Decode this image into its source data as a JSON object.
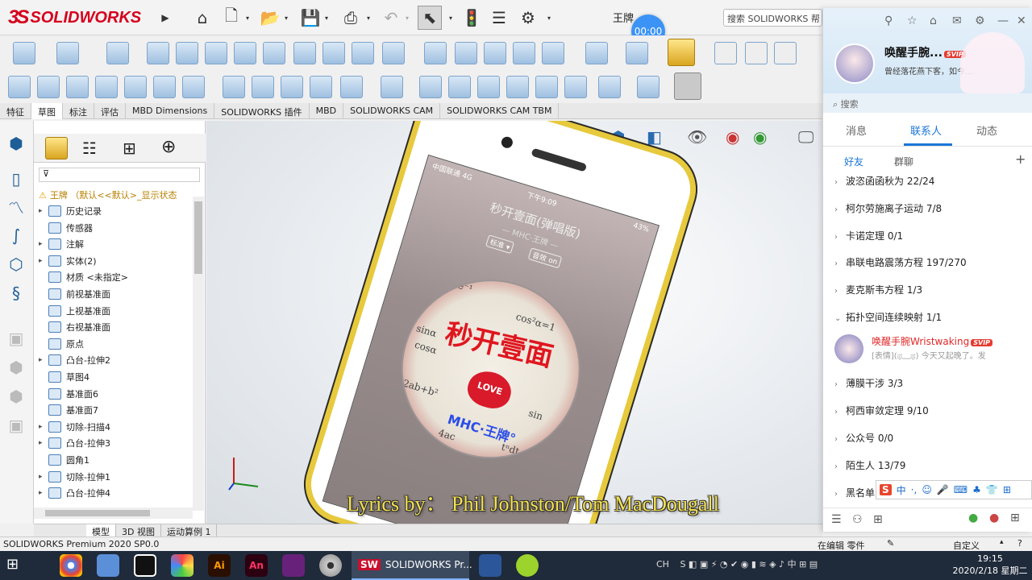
{
  "app": {
    "logo_text": "SOLIDWORKS",
    "logo_mark": "3S",
    "doc_title": "王牌",
    "search_placeholder": "搜索 SOLIDWORKS 帮"
  },
  "timer": "00:00",
  "command_tabs": [
    "特征",
    "草图",
    "标注",
    "评估",
    "MBD Dimensions",
    "SOLIDWORKS 插件",
    "MBD",
    "SOLIDWORKS CAM",
    "SOLIDWORKS CAM TBM"
  ],
  "feature_tree": {
    "root": "王牌 （默认<<默认>_显示状态",
    "items": [
      {
        "label": "历史记录",
        "expand": "▸"
      },
      {
        "label": "传感器",
        "expand": ""
      },
      {
        "label": "注解",
        "expand": "▸"
      },
      {
        "label": "实体(2)",
        "expand": "▸"
      },
      {
        "label": "材质 <未指定>",
        "expand": ""
      },
      {
        "label": "前视基准面",
        "expand": ""
      },
      {
        "label": "上视基准面",
        "expand": ""
      },
      {
        "label": "右视基准面",
        "expand": ""
      },
      {
        "label": "原点",
        "expand": ""
      },
      {
        "label": "凸台-拉伸2",
        "expand": "▸"
      },
      {
        "label": "草图4",
        "expand": ""
      },
      {
        "label": "基准面6",
        "expand": ""
      },
      {
        "label": "基准面7",
        "expand": ""
      },
      {
        "label": "切除-扫描4",
        "expand": "▸"
      },
      {
        "label": "凸台-拉伸3",
        "expand": "▸"
      },
      {
        "label": "圆角1",
        "expand": ""
      },
      {
        "label": "切除-拉伸1",
        "expand": "▸"
      },
      {
        "label": "凸台-拉伸4",
        "expand": "▸"
      }
    ]
  },
  "bottom_tabs": [
    "模型",
    "3D 视图",
    "运动算例 1"
  ],
  "phone_screen": {
    "carrier": "中国联通 4G",
    "time": "下午9:09",
    "battery": "43%",
    "song": "秒开壹面(弹唱版)",
    "artist": "— MHC·王牌 —",
    "pill_standard": "标准 ▾",
    "pill_effect": "音效 on",
    "disc_title": "秒开壹面",
    "disc_love": "LOVE",
    "disc_mhc": "MHC·王牌°",
    "formulas": [
      "e⁻¹",
      "cos²α=1",
      "sinα",
      "cosα",
      "2ab+b²",
      "sin",
      "tⁿdt",
      "4ac"
    ]
  },
  "lyrics": "Lyrics by： Phil Johnston/Tom MacDougall",
  "qq": {
    "name": "唤醒手腕...",
    "vip": "SVIP",
    "signature": "曾经落花燕下客，如今...",
    "search": "搜索",
    "main_tabs": [
      "消息",
      "联系人",
      "动态"
    ],
    "sub_tabs": [
      "好友",
      "群聊"
    ],
    "groups": [
      {
        "label": "波恣函函秋为 22/24",
        "chev": "›"
      },
      {
        "label": "柯尔劳施离子运动 7/8",
        "chev": "›"
      },
      {
        "label": "卡诺定理 0/1",
        "chev": "›"
      },
      {
        "label": "串联电路震荡方程 197/270",
        "chev": "›"
      },
      {
        "label": "麦克斯韦方程 1/3",
        "chev": "›"
      },
      {
        "label": "拓扑空间连续映射 1/1",
        "chev": "⌄"
      }
    ],
    "groups_after": [
      {
        "label": "薄膜干涉 3/3",
        "chev": "›"
      },
      {
        "label": "柯西审敛定理 9/10",
        "chev": "›"
      },
      {
        "label": "公众号 0/0",
        "chev": "›"
      },
      {
        "label": "陌生人 13/79",
        "chev": "›"
      },
      {
        "label": "黑名单",
        "chev": "›"
      }
    ],
    "friend": {
      "name": "唤醒手腕Wristwaking",
      "vip": "SVIP",
      "message": "[表情](ಥ﹏ಥ) 今天又起晚了。发"
    }
  },
  "ime": {
    "cn": "中",
    "dot": "·,"
  },
  "status_bar": {
    "left": "SOLIDWORKS Premium 2020 SP0.0",
    "editing": "在编辑 零件",
    "custom": "自定义"
  },
  "taskbar": {
    "solidworks": "SOLIDWORKS Pr...",
    "ime": "CH",
    "time": "19:15",
    "date": "2020/2/18 星期二"
  }
}
